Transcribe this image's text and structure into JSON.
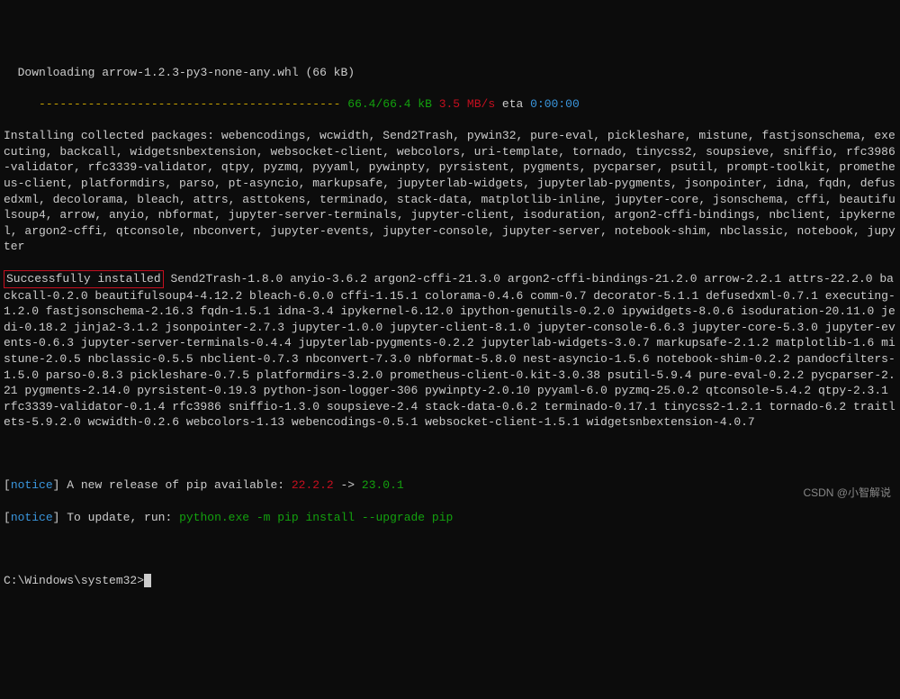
{
  "download": {
    "line": "  Downloading arrow-1.2.3-py3-none-any.whl (66 kB)",
    "bar": "     ------------------------------------------- ",
    "progress_green": "66.4/66.4 kB",
    "speed_red": " 3.5 MB/s",
    "eta_label": " eta ",
    "eta_value": "0:00:00"
  },
  "installing": "Installing collected packages: webencodings, wcwidth, Send2Trash, pywin32, pure-eval, pickleshare, mistune, fastjsonschema, executing, backcall, widgetsnbextension, websocket-client, webcolors, uri-template, tornado, tinycss2, soupsieve, sniffio, rfc3986-validator, rfc3339-validator, qtpy, pyzmq, pyyaml, pywinpty, pyrsistent, pygments, pycparser, psutil, prompt-toolkit, prometheus-client, platformdirs, parso, pt-asyncio, markupsafe, jupyterlab-widgets, jupyterlab-pygments, jsonpointer, idna, fqdn, defusedxml, decolorama, bleach, attrs, asttokens, terminado, stack-data, matplotlib-inline, jupyter-core, jsonschema, cffi, beautifulsoup4, arrow, anyio, nbformat, jupyter-server-terminals, jupyter-client, isoduration, argon2-cffi-bindings, nbclient, ipykernel, argon2-cffi, qtconsole, nbconvert, jupyter-events, jupyter-console, jupyter-server, notebook-shim, nbclassic, notebook, jupyter",
  "success_label": "Successfully installed",
  "success_packages": " Send2Trash-1.8.0 anyio-3.6.2 argon2-cffi-21.3.0 argon2-cffi-bindings-21.2.0 arrow-2.2.1 attrs-22.2.0 backcall-0.2.0 beautifulsoup4-4.12.2 bleach-6.0.0 cffi-1.15.1 colorama-0.4.6 comm-0.7 decorator-5.1.1 defusedxml-0.7.1 executing-1.2.0 fastjsonschema-2.16.3 fqdn-1.5.1 idna-3.4 ipykernel-6.12.0 ipython-genutils-0.2.0 ipywidgets-8.0.6 isoduration-20.11.0 jedi-0.18.2 jinja2-3.1.2 jsonpointer-2.7.3 jupyter-1.0.0 jupyter-client-8.1.0 jupyter-console-6.6.3 jupyter-core-5.3.0 jupyter-events-0.6.3 jupyter-server-terminals-0.4.4 jupyterlab-pygments-0.2.2 jupyterlab-widgets-3.0.7 markupsafe-2.1.2 matplotlib-1.6 mistune-2.0.5 nbclassic-0.5.5 nbclient-0.7.3 nbconvert-7.3.0 nbformat-5.8.0 nest-asyncio-1.5.6 notebook-shim-0.2.2 pandocfilters-1.5.0 parso-0.8.3 pickleshare-0.7.5 platformdirs-3.2.0 prometheus-client-0.kit-3.0.38 psutil-5.9.4 pure-eval-0.2.2 pycparser-2.21 pygments-2.14.0 pyrsistent-0.19.3 python-json-logger-306 pywinpty-2.0.10 pyyaml-6.0 pyzmq-25.0.2 qtconsole-5.4.2 qtpy-2.3.1 rfc3339-validator-0.1.4 rfc3986 sniffio-1.3.0 soupsieve-2.4 stack-data-0.6.2 terminado-0.17.1 tinycss2-1.2.1 tornado-6.2 traitlets-5.9.2.0 wcwidth-0.2.6 webcolors-1.13 webencodings-0.5.1 websocket-client-1.5.1 widgetsnbextension-4.0.7",
  "notice1": {
    "bracket_open": "[",
    "tag": "notice",
    "bracket_close": "] ",
    "text": "A new release of pip available: ",
    "ver_old": "22.2.2",
    "arrow": " -> ",
    "ver_new": "23.0.1"
  },
  "notice2": {
    "bracket_open": "[",
    "tag": "notice",
    "bracket_close": "] ",
    "text": "To update, run: ",
    "cmd": "python.exe -m pip install --upgrade pip"
  },
  "prompt": "C:\\Windows\\system32>",
  "watermark": "CSDN @小智解说"
}
